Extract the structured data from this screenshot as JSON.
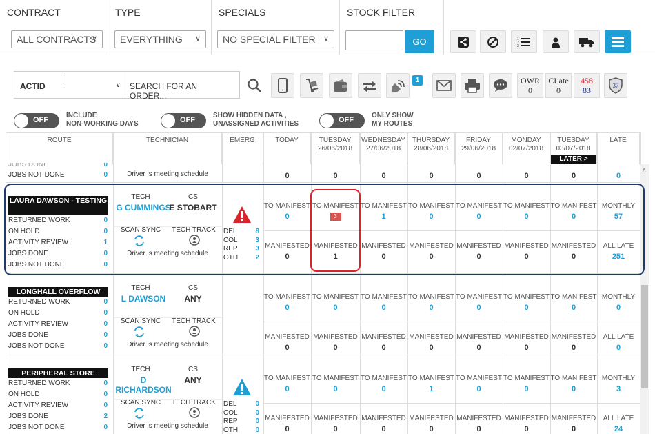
{
  "filters": {
    "contract": {
      "header": "CONTRACT",
      "value": "ALL CONTRACTS"
    },
    "type": {
      "header": "TYPE",
      "value": "EVERYTHING"
    },
    "specials": {
      "header": "SPECIALS",
      "value": "NO SPECIAL FILTER"
    },
    "stock": {
      "header": "STOCK FILTER",
      "value": "",
      "go": "GO"
    }
  },
  "toolbar_icons": [
    "share-icon",
    "ban-icon",
    "numbered-list-icon",
    "user-icon",
    "truck-icon",
    "menu-icon"
  ],
  "search": {
    "scope": "ACTID",
    "placeholder": "SEARCH FOR AN ORDER...",
    "badge": "1",
    "owr": {
      "label": "OWR",
      "value": "0"
    },
    "clate": {
      "label": "CLate",
      "value": "0"
    },
    "counter": {
      "top": "458",
      "bottom": "83"
    },
    "shield": "37"
  },
  "toggles": [
    {
      "state": "OFF",
      "label_line1": "INCLUDE",
      "label_line2": "NON-WORKING DAYS"
    },
    {
      "state": "OFF",
      "label_line1": "SHOW HIDDEN DATA ,",
      "label_line2": "UNASSIGNED ACTIVITIES"
    },
    {
      "state": "OFF",
      "label_line1": "ONLY SHOW",
      "label_line2": "MY ROUTES"
    }
  ],
  "columns": {
    "route": "ROUTE",
    "technician": "TECHNICIAN",
    "emerg": "EMERG",
    "days": [
      {
        "day": "TODAY",
        "date": ""
      },
      {
        "day": "TUESDAY",
        "date": "26/06/2018"
      },
      {
        "day": "WEDNESDAY",
        "date": "27/06/2018"
      },
      {
        "day": "THURSDAY",
        "date": "28/06/2018"
      },
      {
        "day": "FRIDAY",
        "date": "29/06/2018"
      },
      {
        "day": "MONDAY",
        "date": "02/07/2018"
      },
      {
        "day": "TUESDAY",
        "date": "03/07/2018"
      }
    ],
    "later": "LATER >",
    "late": "LATE"
  },
  "partial_row": {
    "cut_labels": [
      "JOBS DONE",
      "JOBS NOT DONE"
    ],
    "cut_values": [
      "0",
      "0"
    ],
    "driver_text": "Driver is meeting schedule",
    "values": [
      "0",
      "0",
      "0",
      "0",
      "0",
      "0",
      "0",
      "0"
    ]
  },
  "routes": [
    {
      "name": "LAURA DAWSON - TESTING",
      "stats": [
        {
          "label": "RETURNED WORK",
          "value": "0"
        },
        {
          "label": "ON HOLD",
          "value": "0"
        },
        {
          "label": "ACTIVITY REVIEW",
          "value": "1"
        },
        {
          "label": "JOBS DONE",
          "value": "0"
        },
        {
          "label": "JOBS NOT DONE",
          "value": "0"
        }
      ],
      "tech_label": "TECH",
      "tech": "G CUMMINGS",
      "cs_label": "CS",
      "cs": "E STOBART",
      "scan_sync": "SCAN SYNC",
      "tech_track": "TECH TRACK",
      "driver_text": "Driver is meeting schedule",
      "emerg": {
        "icon": "alert-red",
        "rows": [
          {
            "label": "DEL",
            "value": "8"
          },
          {
            "label": "COL",
            "value": "3"
          },
          {
            "label": "REP",
            "value": "3"
          },
          {
            "label": "OTH",
            "value": "2"
          }
        ]
      },
      "to_manifest": [
        "0",
        "3",
        "1",
        "0",
        "0",
        "0",
        "0"
      ],
      "manifested": [
        "0",
        "1",
        "0",
        "0",
        "0",
        "0",
        "0"
      ],
      "monthly": "57",
      "all_late": "251"
    },
    {
      "name": "LONGHALL OVERFLOW",
      "stats": [
        {
          "label": "RETURNED WORK",
          "value": "0"
        },
        {
          "label": "ON HOLD",
          "value": "0"
        },
        {
          "label": "ACTIVITY REVIEW",
          "value": "0"
        },
        {
          "label": "JOBS DONE",
          "value": "0"
        },
        {
          "label": "JOBS NOT DONE",
          "value": "0"
        }
      ],
      "tech_label": "TECH",
      "tech": "L DAWSON",
      "cs_label": "CS",
      "cs": "ANY",
      "scan_sync": "SCAN SYNC",
      "tech_track": "TECH TRACK",
      "driver_text": "Driver is meeting schedule",
      "to_manifest": [
        "0",
        "0",
        "0",
        "0",
        "0",
        "0",
        "0"
      ],
      "manifested": [
        "0",
        "0",
        "0",
        "0",
        "0",
        "0",
        "0"
      ],
      "monthly": "0",
      "all_late": "0"
    },
    {
      "name": "PERIPHERAL STORE",
      "stats": [
        {
          "label": "RETURNED WORK",
          "value": "0"
        },
        {
          "label": "ON HOLD",
          "value": "0"
        },
        {
          "label": "ACTIVITY REVIEW",
          "value": "0"
        },
        {
          "label": "JOBS DONE",
          "value": "2"
        },
        {
          "label": "JOBS NOT DONE",
          "value": "0"
        }
      ],
      "tech_label": "TECH",
      "tech": "D RICHARDSON",
      "cs_label": "CS",
      "cs": "ANY",
      "scan_sync": "SCAN SYNC",
      "tech_track": "TECH TRACK",
      "driver_text": "Driver is meeting schedule",
      "emerg": {
        "icon": "alert-blue",
        "rows": [
          {
            "label": "DEL",
            "value": "0"
          },
          {
            "label": "COL",
            "value": "0"
          },
          {
            "label": "REP",
            "value": "0"
          },
          {
            "label": "OTH",
            "value": "0"
          }
        ]
      },
      "to_manifest": [
        "0",
        "0",
        "0",
        "1",
        "0",
        "0",
        "0"
      ],
      "manifested": [
        "0",
        "0",
        "0",
        "0",
        "0",
        "0",
        "0"
      ],
      "monthly": "3",
      "all_late": "24"
    }
  ],
  "labels": {
    "to_manifest": "TO MANIFEST",
    "manifested": "MANIFESTED",
    "monthly": "MONTHLY",
    "all_late": "ALL LATE"
  },
  "colors": {
    "accent": "#1ea0d6",
    "highlight_red": "#d9242b",
    "highlight_navy": "#1f3a6e"
  }
}
